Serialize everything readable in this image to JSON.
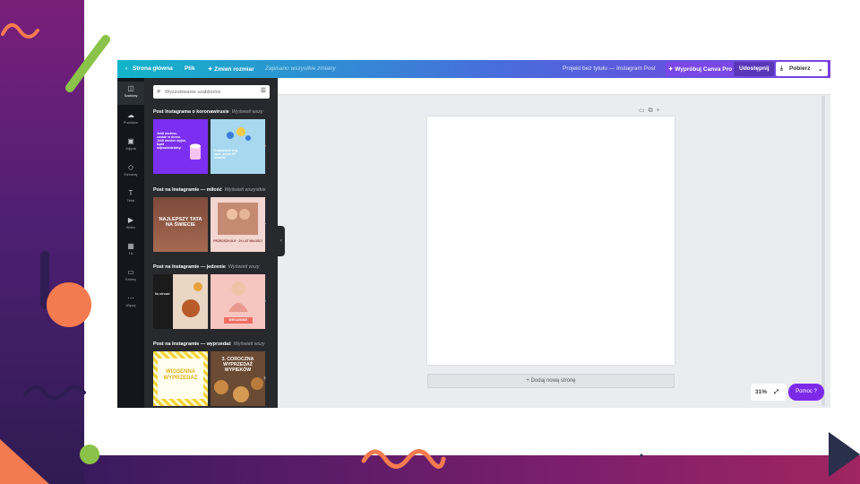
{
  "colors": {
    "slide_purple": "#4f1f73",
    "slide_orange": "#f47a50",
    "slide_lime": "#8bc34a",
    "canva_purple": "#7d2ae8",
    "canva_teal": "#12b5c9"
  },
  "topbar": {
    "home": "Strona główna",
    "file": "Plik",
    "resize": "Zmień rozmiar",
    "saved": "Zapisano wszystkie zmiany",
    "title": "Projekt bez tytułu — Instagram Post",
    "pro": "Wypróbuj Canva Pro",
    "share": "Udostępnij",
    "download": "Pobierz"
  },
  "rail": [
    {
      "icon": "layout-icon",
      "label": "Szablony"
    },
    {
      "icon": "upload-icon",
      "label": "Przesłane"
    },
    {
      "icon": "photo-icon",
      "label": "Zdjęcia"
    },
    {
      "icon": "elements-icon",
      "label": "Elementy"
    },
    {
      "icon": "text-icon",
      "label": "Tekst"
    },
    {
      "icon": "video-icon",
      "label": "Wideo"
    },
    {
      "icon": "background-icon",
      "label": "Tło"
    },
    {
      "icon": "folder-icon",
      "label": "Foldery"
    },
    {
      "icon": "more-icon",
      "label": "Więcej"
    }
  ],
  "search": {
    "placeholder": "Wyszukiwanie szablonów"
  },
  "sections": [
    {
      "title": "Post Instagrama o koronawirusie",
      "more": "Wyświetl wszy",
      "t1": "Jeśli możesz, zostań w domu. Jeśli musisz wyjść, bądź odpowiedzialny.",
      "t2": "Codziennie myj ręce, przez 20 sekund"
    },
    {
      "title": "Post na Instagramie — miłość",
      "more": "Wyświetl wszystkie",
      "t1": "NAJLEPSZY TATA NA ŚWIECIE",
      "t2": "PRZEDSZKOLE · 20 LAT MIŁOŚCI"
    },
    {
      "title": "Post na Instagramie — jedzenie",
      "more": "Wyświetl wszy",
      "t1": "Na zdrowie",
      "t2": "WEGAŃSKIE"
    },
    {
      "title": "Post na Instagramie — wyprzedaż",
      "more": "Wyświetl wszy",
      "t1": "WIOSENNA WYPRZEDAŻ",
      "t2": "3. COROCZNA WYPRZEDAŻ WYPIEKÓW"
    }
  ],
  "canvas": {
    "add_page": "+ Dodaj nową stronę"
  },
  "zoom": {
    "level": "31%"
  },
  "help": {
    "label": "Pomoc ?"
  }
}
